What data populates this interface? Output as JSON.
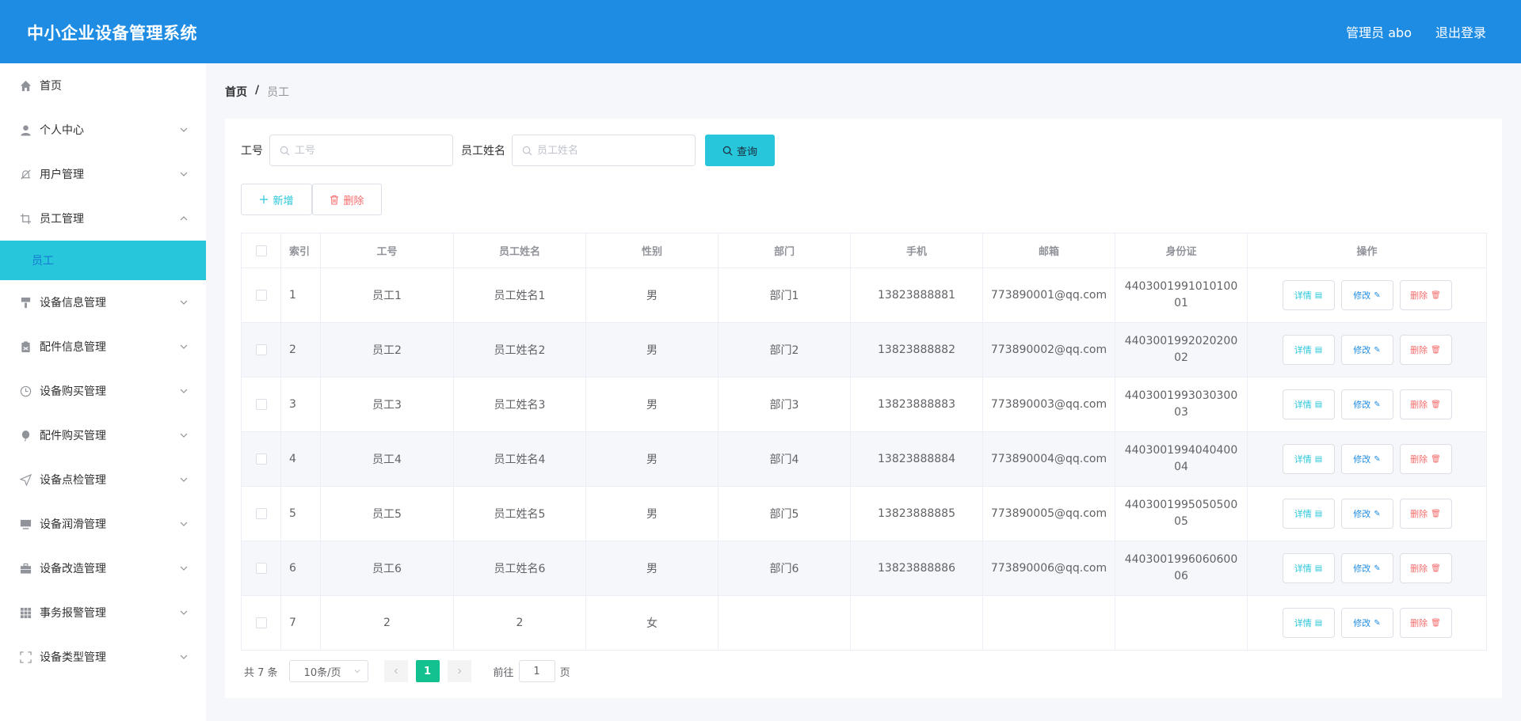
{
  "header": {
    "title": "中小企业设备管理系统",
    "admin_label": "管理员 abo",
    "logout_label": "退出登录"
  },
  "sidebar": {
    "items": [
      {
        "label": "首页",
        "icon": "home-icon"
      },
      {
        "label": "个人中心",
        "icon": "user-icon"
      },
      {
        "label": "用户管理",
        "icon": "bell-off-icon"
      },
      {
        "label": "员工管理",
        "icon": "crop-icon"
      },
      {
        "label": "员工",
        "icon": ""
      },
      {
        "label": "设备信息管理",
        "icon": "brush-icon"
      },
      {
        "label": "配件信息管理",
        "icon": "clipboard-icon"
      },
      {
        "label": "设备购买管理",
        "icon": "clock-icon"
      },
      {
        "label": "配件购买管理",
        "icon": "balloon-icon"
      },
      {
        "label": "设备点检管理",
        "icon": "send-icon"
      },
      {
        "label": "设备润滑管理",
        "icon": "monitor-icon"
      },
      {
        "label": "设备改造管理",
        "icon": "briefcase-icon"
      },
      {
        "label": "事务报警管理",
        "icon": "grid-icon"
      },
      {
        "label": "设备类型管理",
        "icon": "fullscreen-icon"
      }
    ]
  },
  "breadcrumb": {
    "home": "首页",
    "separator": "/",
    "current": "员工"
  },
  "search": {
    "id_label": "工号",
    "id_placeholder": "工号",
    "name_label": "员工姓名",
    "name_placeholder": "员工姓名",
    "query_label": "查询"
  },
  "actions": {
    "add_label": "新增",
    "delete_label": "删除"
  },
  "table": {
    "headers": [
      "索引",
      "工号",
      "员工姓名",
      "性别",
      "部门",
      "手机",
      "邮箱",
      "身份证",
      "操作"
    ],
    "rows": [
      {
        "index": "1",
        "id": "员工1",
        "name": "员工姓名1",
        "gender": "男",
        "dept": "部门1",
        "phone": "13823888881",
        "email": "773890001@qq.com",
        "idcard": "440300199101010001"
      },
      {
        "index": "2",
        "id": "员工2",
        "name": "员工姓名2",
        "gender": "男",
        "dept": "部门2",
        "phone": "13823888882",
        "email": "773890002@qq.com",
        "idcard": "440300199202020002"
      },
      {
        "index": "3",
        "id": "员工3",
        "name": "员工姓名3",
        "gender": "男",
        "dept": "部门3",
        "phone": "13823888883",
        "email": "773890003@qq.com",
        "idcard": "440300199303030003"
      },
      {
        "index": "4",
        "id": "员工4",
        "name": "员工姓名4",
        "gender": "男",
        "dept": "部门4",
        "phone": "13823888884",
        "email": "773890004@qq.com",
        "idcard": "440300199404040004"
      },
      {
        "index": "5",
        "id": "员工5",
        "name": "员工姓名5",
        "gender": "男",
        "dept": "部门5",
        "phone": "13823888885",
        "email": "773890005@qq.com",
        "idcard": "440300199505050005"
      },
      {
        "index": "6",
        "id": "员工6",
        "name": "员工姓名6",
        "gender": "男",
        "dept": "部门6",
        "phone": "13823888886",
        "email": "773890006@qq.com",
        "idcard": "440300199606060006"
      },
      {
        "index": "7",
        "id": "2",
        "name": "2",
        "gender": "女",
        "dept": "",
        "phone": "",
        "email": "",
        "idcard": ""
      }
    ],
    "ops": {
      "detail": "详情",
      "edit": "修改",
      "remove": "删除"
    }
  },
  "pagination": {
    "total_text": "共 7 条",
    "page_size": "10条/页",
    "current_page": "1",
    "goto_prefix": "前往",
    "goto_value": "1",
    "goto_suffix": "页"
  },
  "colors": {
    "header_bg": "#1f8ce3",
    "accent_cyan": "#27c6da",
    "danger": "#f56c6c",
    "page_active": "#13c08f"
  }
}
